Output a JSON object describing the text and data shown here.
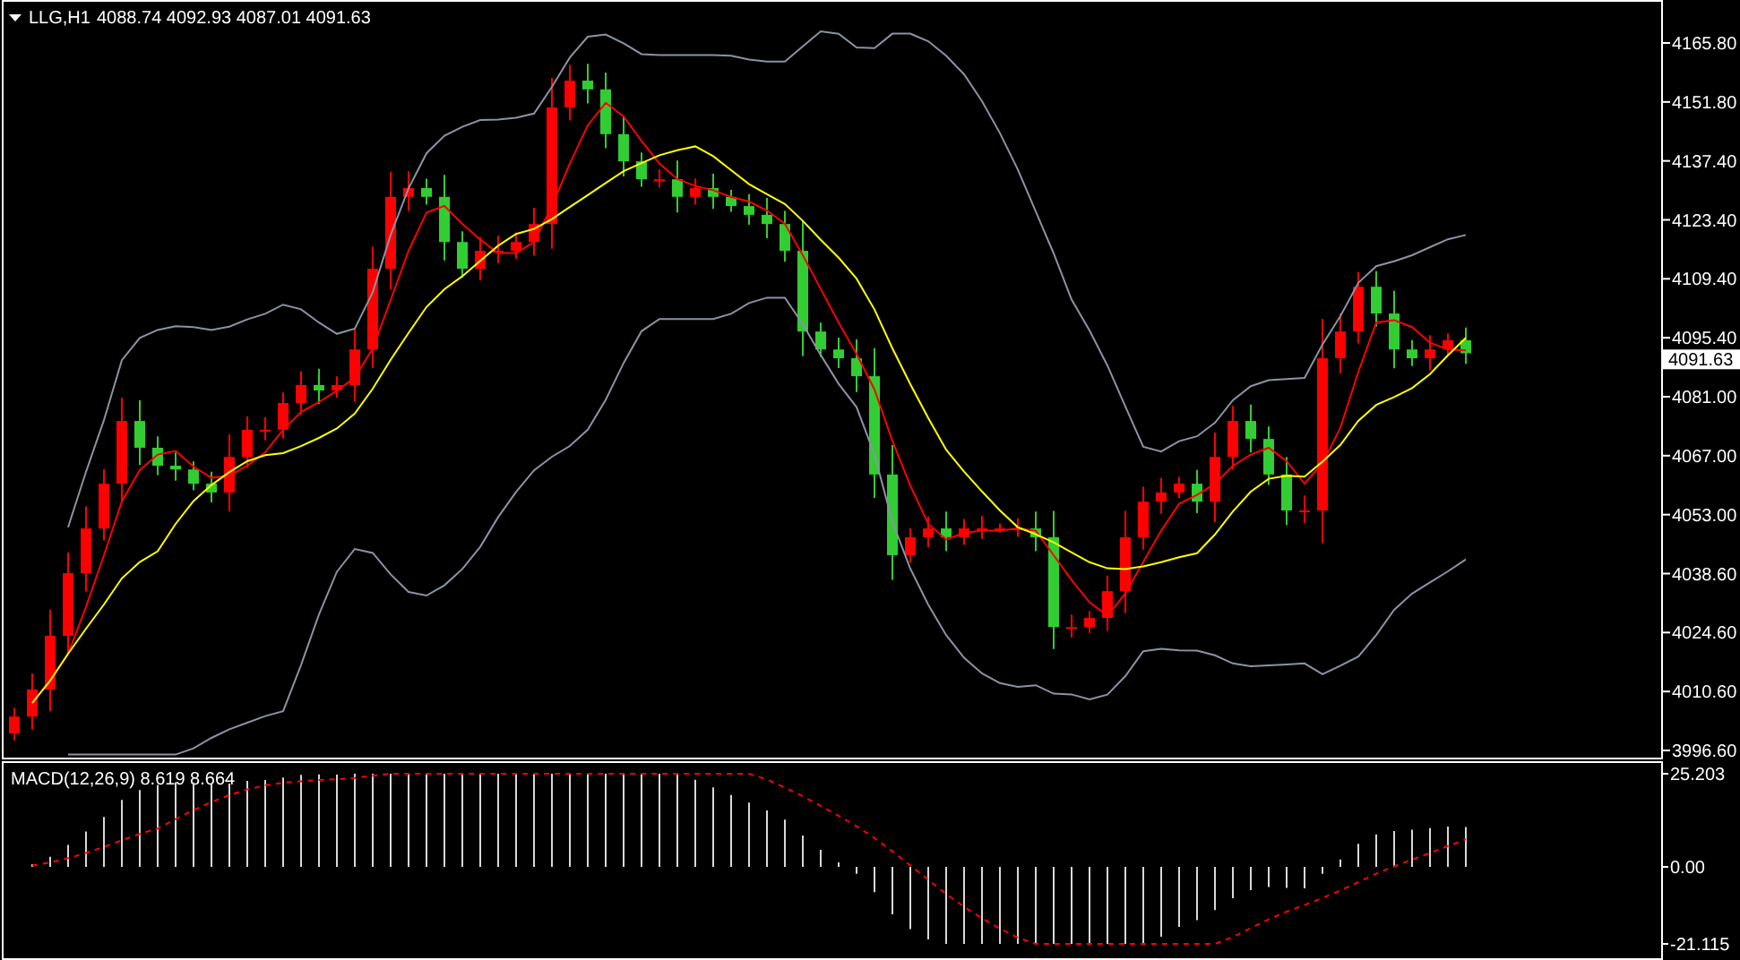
{
  "header": {
    "symbol": "LLG,H1",
    "ohlc": [
      "4088.74",
      "4092.93",
      "4087.01",
      "4091.63"
    ]
  },
  "price_chart": {
    "current_price": "4091.63",
    "axis_labels": [
      "4165.80",
      "4151.80",
      "4137.40",
      "4123.40",
      "4109.40",
      "4095.40",
      "4081.00",
      "4067.00",
      "4053.00",
      "4038.60",
      "4024.60",
      "4010.60",
      "3996.60"
    ]
  },
  "macd_panel": {
    "label": "MACD(12,26,9) 8.619 8.664",
    "axis_labels": [
      "25.203",
      "0.00",
      "-21.115"
    ]
  }
}
